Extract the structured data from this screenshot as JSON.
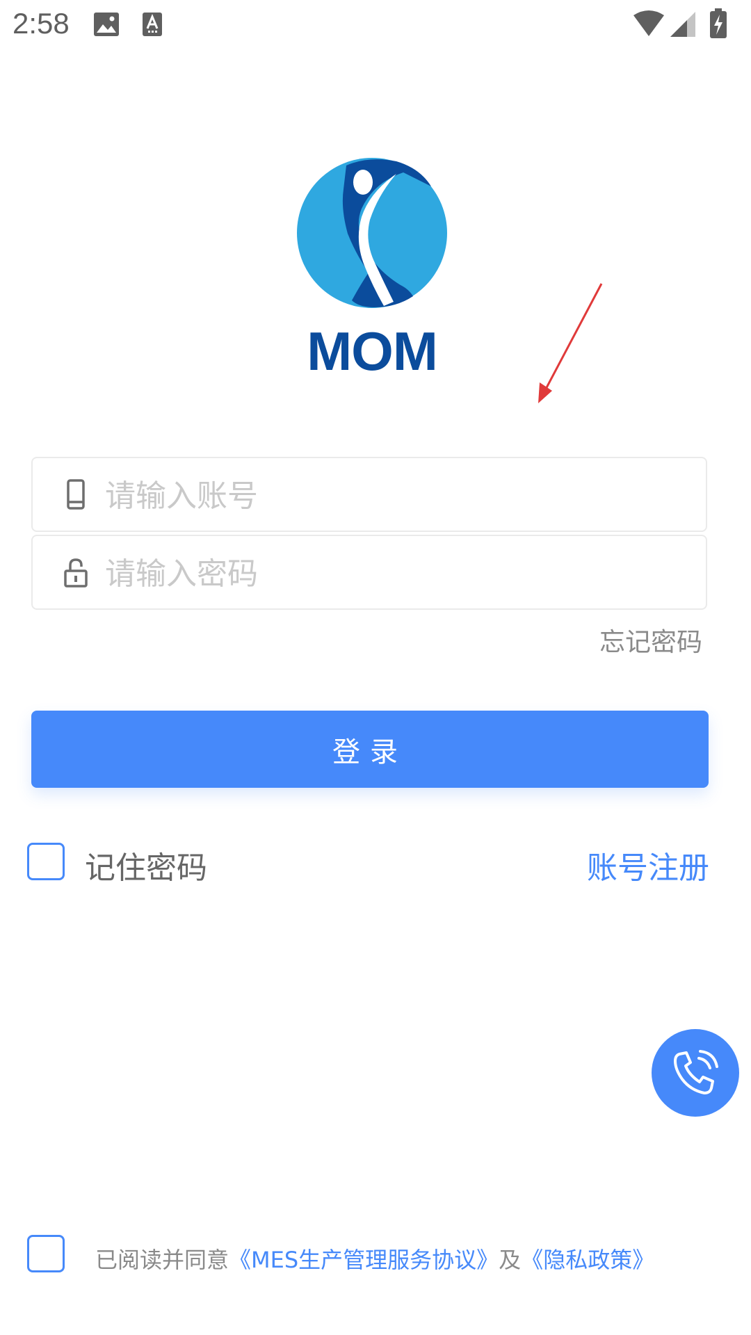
{
  "status_bar": {
    "time": "2:58",
    "icons": [
      "image-icon",
      "a-notification-icon",
      "wifi-icon",
      "cell-signal-icon",
      "battery-charging-icon"
    ]
  },
  "logo": {
    "text": "MOM",
    "colors": {
      "primary": "#0b4c9c",
      "secondary": "#2fa8e0"
    }
  },
  "form": {
    "account_placeholder": "请输入账号",
    "password_placeholder": "请输入密码",
    "forgot_password_label": "忘记密码",
    "login_label": "登录"
  },
  "options": {
    "remember_password_label": "记住密码",
    "register_label": "账号注册"
  },
  "agreement": {
    "prefix": "已阅读并同意",
    "service_agreement": "《MES生产管理服务协议》",
    "connector": "及",
    "privacy_policy": "《隐私政策》"
  },
  "colors": {
    "accent": "#4689fa",
    "annotation_arrow": "#e03a3a"
  }
}
